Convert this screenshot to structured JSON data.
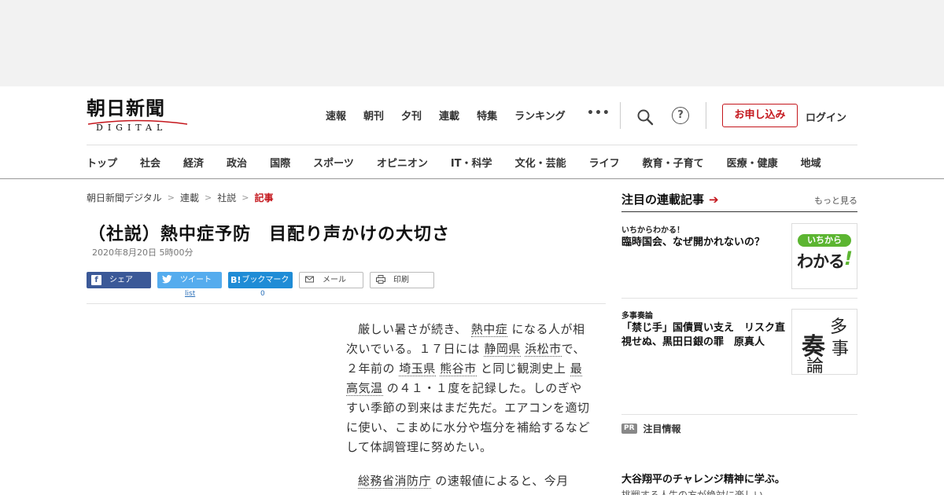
{
  "header": {
    "logo": {
      "kanji": "朝日新聞",
      "sub": "DIGITAL"
    },
    "top_nav": [
      "速報",
      "朝刊",
      "夕刊",
      "連載",
      "特集",
      "ランキング"
    ],
    "subscribe": "お申し込み",
    "login": "ログイン"
  },
  "category_nav": [
    "トップ",
    "社会",
    "経済",
    "政治",
    "国際",
    "スポーツ",
    "オピニオン",
    "IT・科学",
    "文化・芸能",
    "ライフ",
    "教育・子育て",
    "医療・健康",
    "地域"
  ],
  "breadcrumb": [
    "朝日新聞デジタル",
    "連載",
    "社説",
    "記事"
  ],
  "article": {
    "title": "（社説）熱中症予防　目配り声かけの大切さ",
    "date": "2020年8月20日 5時00分",
    "share": {
      "facebook": "シェア",
      "twitter": "ツイート",
      "hatena": "ブックマーク",
      "hatena_icon": "B!",
      "mail": "メール",
      "print": "印刷",
      "twitter_count": "list",
      "hatena_count": "0"
    },
    "p1": {
      "t1": "厳しい暑さが続き、",
      "k1": "熱中症",
      "t2": "になる人が相次いでいる。１７日には",
      "k2": "静岡県",
      "k3": "浜松市",
      "t3": "で、２年前の",
      "k4": "埼玉県",
      "k5": "熊谷市",
      "t4": "と同じ観測史上",
      "k6": "最高気温",
      "t5": "の４１・１度を記録した。しのぎやすい季節の到来はまだ先だ。エアコンを適切に使い、こまめに水分や塩分を補給するなどして体調管理に努めたい。"
    },
    "p2": {
      "k1": "総務省消防庁",
      "t1": "の速報値によると、今月"
    }
  },
  "sidebar": {
    "heading": "注目の連載記事",
    "more": "もっと見る",
    "cards": [
      {
        "tag": "いちからわかる！",
        "title": "臨時国会、なぜ開かれないの？",
        "thumb_text1": "いちから",
        "thumb_text2": "わかる",
        "thumb_text3": "!"
      },
      {
        "tag": "多事奏論",
        "title": "「禁じ手」国債買い支え　リスク直視せぬ、黒田日銀の罪　原真人",
        "thumb_chars": [
          "多",
          "奏",
          "事",
          "論"
        ]
      }
    ],
    "pr_badge": "PR",
    "pr_label": "注目情報",
    "pr_item_title": "大谷翔平のチャレンジ精神に学ぶ。",
    "pr_item_sub": "挑戦する人生の方が絶対に楽しい"
  },
  "colors": {
    "brand_red": "#c4161c",
    "facebook": "#3b5998",
    "twitter": "#55acee",
    "hatena": "#1f8cd6",
    "ichikara_green": "#5cb531"
  }
}
